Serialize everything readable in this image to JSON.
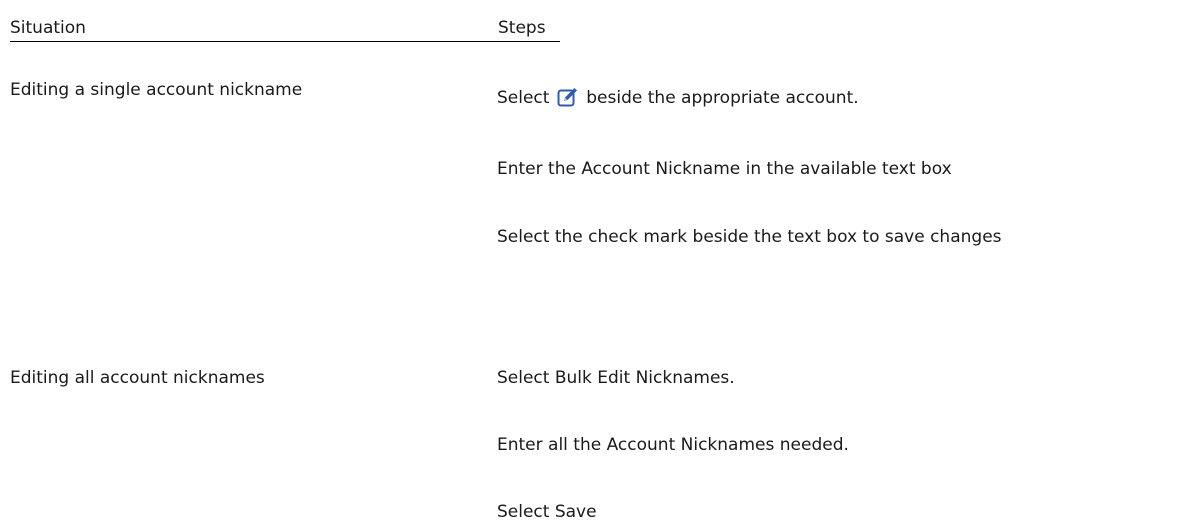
{
  "headers": {
    "situation": "Situation",
    "steps": "Steps"
  },
  "rows": [
    {
      "situation": "Editing a single account nickname",
      "steps": [
        {
          "before": "Select",
          "icon": "edit-icon",
          "after": "beside the appropriate account."
        },
        {
          "text": "Enter the Account Nickname in the available text box"
        },
        {
          "text": "Select the check mark beside the text box to save changes"
        }
      ]
    },
    {
      "situation": "Editing all account nicknames",
      "steps": [
        {
          "text": "Select Bulk Edit Nicknames."
        },
        {
          "text": "Enter all the Account Nicknames needed."
        },
        {
          "text": "Select Save"
        }
      ]
    }
  ]
}
